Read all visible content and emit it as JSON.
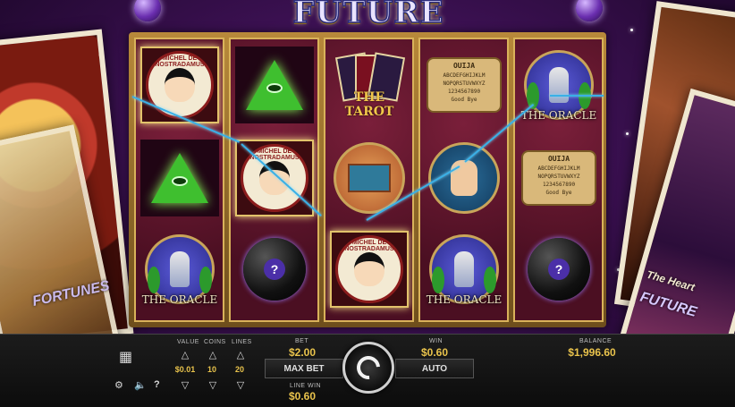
{
  "game": {
    "title": "Future Fortunes",
    "title_display": "FUTURE FORTUNES"
  },
  "side_cards": {
    "left_word": "FORTUNES",
    "right_word_1": "The Heart",
    "right_word_2": "FUTURE"
  },
  "reels": [
    [
      {
        "symbol": "nostradamus",
        "label": "MICHEL DE NOSTRADAMUS",
        "win": true
      },
      {
        "symbol": "eye",
        "label": "",
        "win": false
      },
      {
        "symbol": "oracle",
        "label": "THE ORACLE",
        "win": false
      }
    ],
    [
      {
        "symbol": "eye",
        "label": "",
        "win": false
      },
      {
        "symbol": "nostradamus",
        "label": "MICHEL DE NOSTRADAMUS",
        "win": true
      },
      {
        "symbol": "8ball",
        "label": "?",
        "win": false
      }
    ],
    [
      {
        "symbol": "tarot",
        "label": "THE TAROT",
        "win": false
      },
      {
        "symbol": "wagon",
        "label": "",
        "win": false
      },
      {
        "symbol": "nostradamus",
        "label": "MICHEL DE NOSTRADAMUS",
        "win": true
      }
    ],
    [
      {
        "symbol": "ouija",
        "label": "OUIJA",
        "win": false
      },
      {
        "symbol": "palm",
        "label": "",
        "win": false
      },
      {
        "symbol": "oracle",
        "label": "THE ORACLE",
        "win": false
      }
    ],
    [
      {
        "symbol": "oracle",
        "label": "THE ORACLE",
        "win": false
      },
      {
        "symbol": "ouija",
        "label": "OUIJA",
        "win": false
      },
      {
        "symbol": "8ball",
        "label": "?",
        "win": false
      }
    ]
  ],
  "ouija_lines": [
    "ABCDEFGHIJKLM",
    "NOPQRSTUVWXYZ",
    "1234567890",
    "Good Bye"
  ],
  "controls": {
    "value_label": "VALUE",
    "value": "$0.01",
    "coins_label": "COINS",
    "coins": "10",
    "lines_label": "LINES",
    "lines": "20",
    "bet_label": "BET",
    "bet": "$2.00",
    "win_label": "WIN",
    "win": "$0.60",
    "line_win_label": "LINE WIN",
    "line_win": "$0.60",
    "balance_label": "BALANCE",
    "balance": "$1,996.60",
    "max_bet_label": "MAX BET",
    "auto_label": "AUTO"
  },
  "colors": {
    "accent_gold": "#e9c34c",
    "payline": "#3ab0e6",
    "background": "#3a1050"
  },
  "icons": [
    "paytable-icon",
    "settings-icon",
    "sound-icon",
    "help-icon",
    "spin-icon"
  ]
}
